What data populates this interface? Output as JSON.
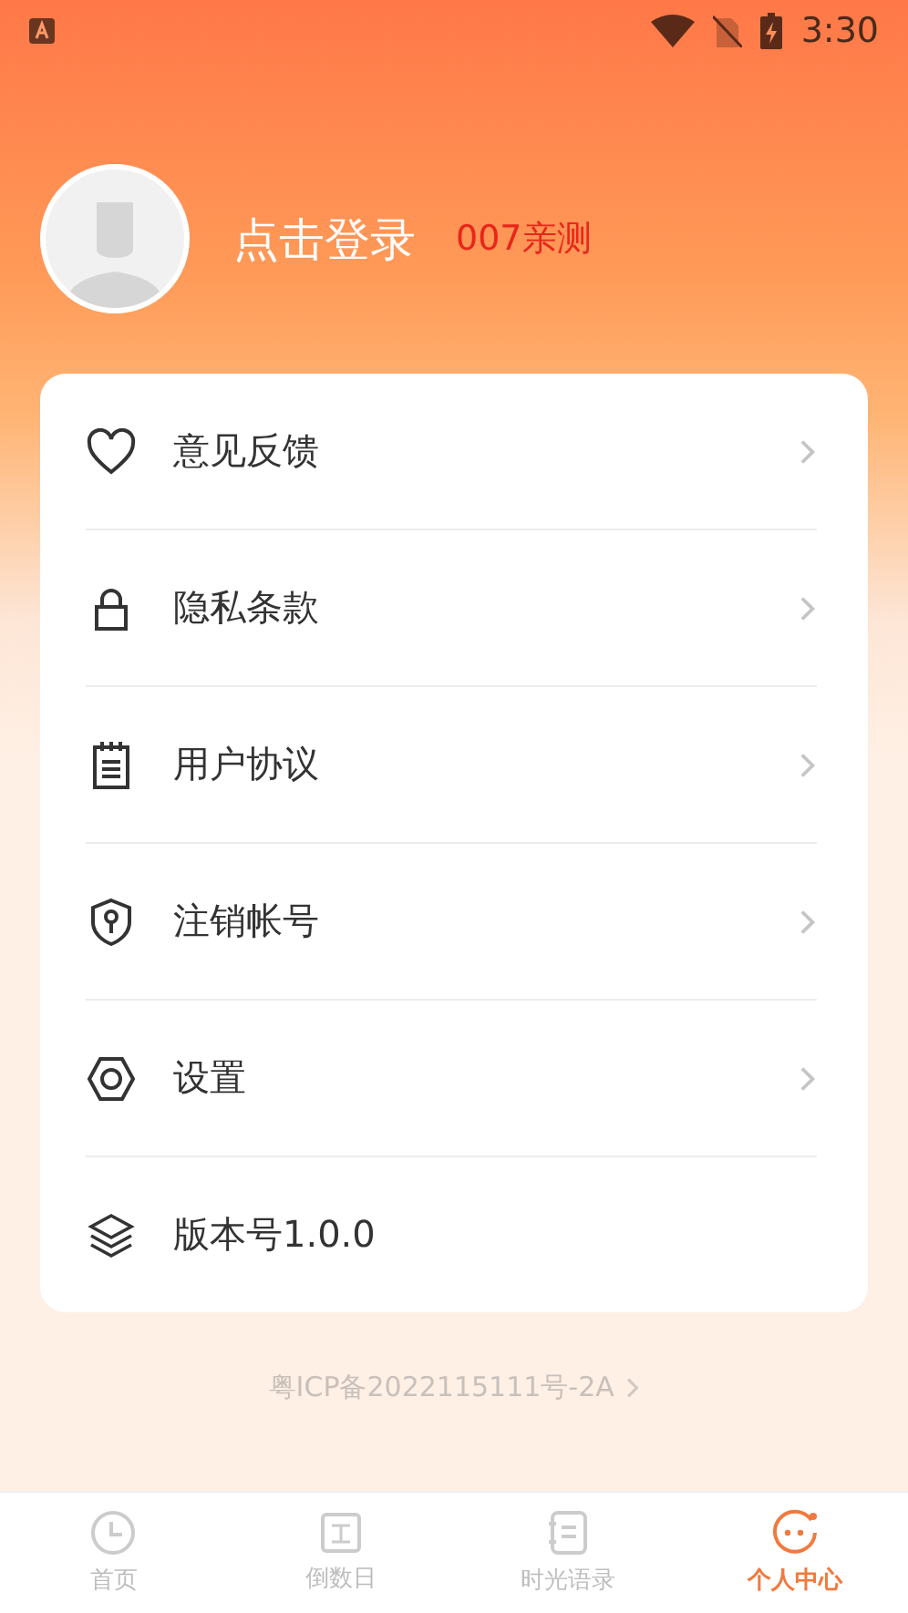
{
  "status_bar": {
    "time": "3:30"
  },
  "profile": {
    "login": "点击登录",
    "tag": "007亲测"
  },
  "menu": [
    {
      "label": "意见反馈",
      "kind": "link"
    },
    {
      "label": "隐私条款",
      "kind": "link"
    },
    {
      "label": "用户协议",
      "kind": "link"
    },
    {
      "label": "注销帐号",
      "kind": "link"
    },
    {
      "label": "设置",
      "kind": "link"
    },
    {
      "label": "版本号1.0.0",
      "kind": "info"
    }
  ],
  "icp": "粤ICP备2022115111号-2A",
  "tabs": [
    {
      "label": "首页",
      "selected": false
    },
    {
      "label": "倒数日",
      "selected": false
    },
    {
      "label": "时光语录",
      "selected": false
    },
    {
      "label": "个人中心",
      "selected": true
    }
  ]
}
